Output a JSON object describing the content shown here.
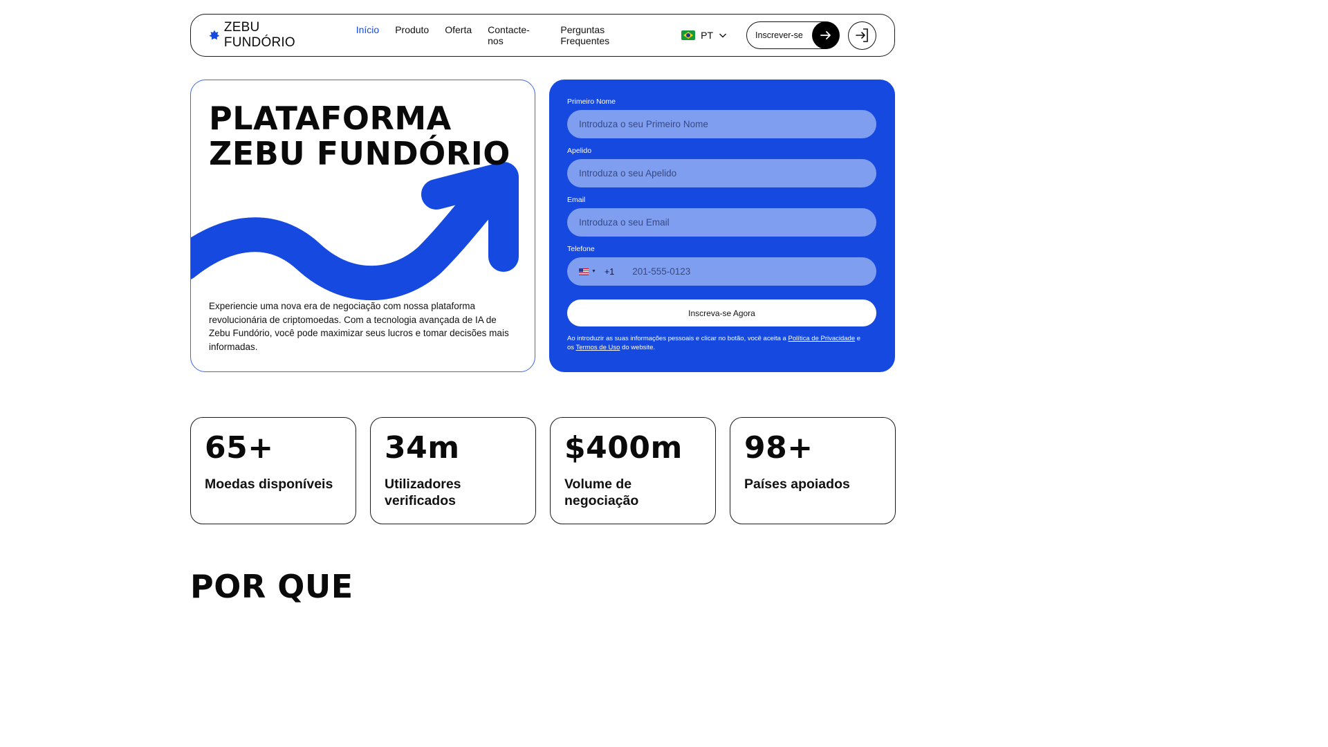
{
  "brand": {
    "name": "ZEBU FUNDÓRIO",
    "icon": "star-icon",
    "accent": "#1649e0"
  },
  "nav": {
    "links": [
      {
        "label": "Início",
        "active": true
      },
      {
        "label": "Produto",
        "active": false
      },
      {
        "label": "Oferta",
        "active": false
      },
      {
        "label": "Contacte-nos",
        "active": false
      },
      {
        "label": "Perguntas Frequentes",
        "active": false
      }
    ],
    "language": {
      "code": "PT",
      "flag": "brazil-flag-icon"
    },
    "signup_label": "Inscrever-se",
    "login_icon": "login-icon"
  },
  "hero": {
    "title_line1": "PLATAFORMA",
    "title_line2": "ZEBU FUNDÓRIO",
    "description": "Experiencie uma nova era de negociação com nossa plataforma revolucionária de criptomoedas. Com a tecnologia avançada de IA de Zebu Fundório, você pode maximizar seus lucros e tomar decisões mais informadas."
  },
  "form": {
    "first_name": {
      "label": "Primeiro Nome",
      "placeholder": "Introduza o seu Primeiro Nome"
    },
    "last_name": {
      "label": "Apelido",
      "placeholder": "Introduza o seu Apelido"
    },
    "email": {
      "label": "Email",
      "placeholder": "Introduza o seu Email"
    },
    "phone": {
      "label": "Telefone",
      "dial_code": "+1",
      "placeholder": "201-555-0123",
      "flag": "us-flag-icon"
    },
    "submit_label": "Inscreva-se Agora",
    "consent_prefix": "Ao introduzir as suas informações pessoais e clicar no botão, você aceita a ",
    "privacy_link": "Política de Privacidade",
    "consent_middle": " e os ",
    "terms_link": "Termos de Uso",
    "consent_suffix": " do website."
  },
  "stats": [
    {
      "value": "65+",
      "label": "Moedas disponíveis"
    },
    {
      "value": "34m",
      "label": "Utilizadores verificados"
    },
    {
      "value": "$400m",
      "label": "Volume de negociação"
    },
    {
      "value": "98+",
      "label": "Países apoiados"
    }
  ],
  "section": {
    "title": "POR QUE"
  }
}
